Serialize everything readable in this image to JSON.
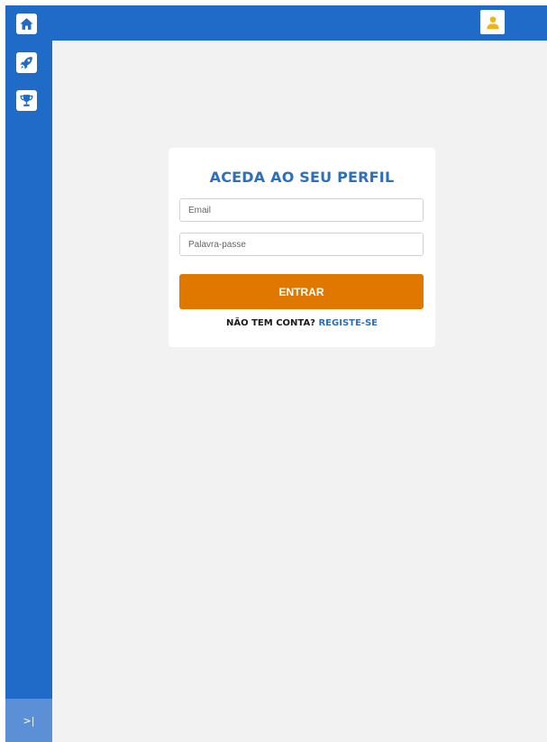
{
  "sidebar": {
    "items": [
      {
        "icon": "home-icon"
      },
      {
        "icon": "rocket-icon"
      },
      {
        "icon": "trophy-icon"
      }
    ],
    "expand_label": ">|"
  },
  "topbar": {
    "avatar_icon": "user-icon"
  },
  "login": {
    "title": "ACEDA AO SEU PERFIL",
    "email_placeholder": "Email",
    "password_placeholder": "Palavra-passe",
    "submit_label": "ENTRAR",
    "no_account_text": "NÃO TEM CONTA?",
    "register_label": "REGISTE-SE"
  },
  "colors": {
    "primary": "#1f6bc7",
    "accent": "#e07800",
    "title": "#2c6fbd",
    "avatar": "#f2b50f",
    "background": "#f2f2f2"
  }
}
